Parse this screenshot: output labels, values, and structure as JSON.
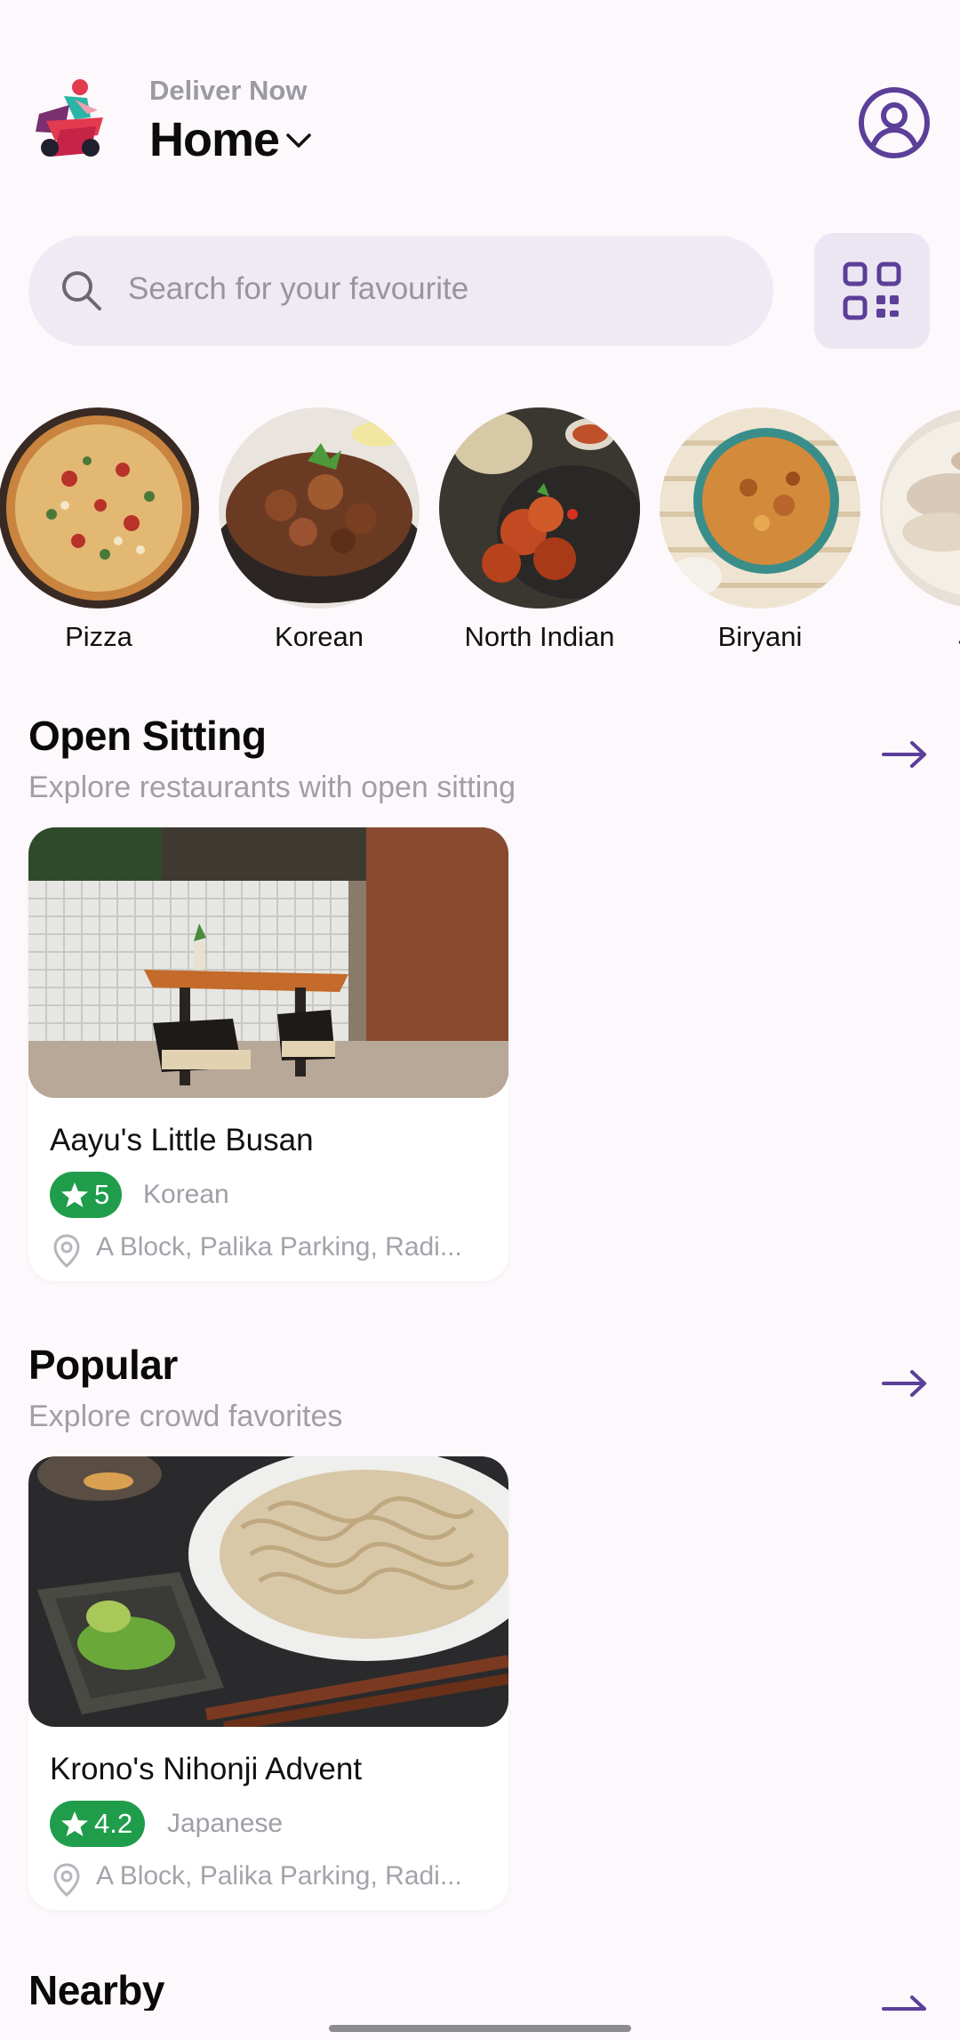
{
  "header": {
    "deliver_label": "Deliver Now",
    "location": "Home",
    "logo_icon": "delivery-rider-logo",
    "profile_icon": "user-circle-icon"
  },
  "search": {
    "placeholder": "Search for your favourite",
    "icon": "search-icon",
    "qr_icon": "qr-code-icon"
  },
  "categories": [
    {
      "label": "Pizza"
    },
    {
      "label": "Korean"
    },
    {
      "label": "North Indian"
    },
    {
      "label": "Biryani"
    },
    {
      "label": "Jap"
    }
  ],
  "sections": [
    {
      "title": "Open Sitting",
      "subtitle": "Explore restaurants with open sitting",
      "card": {
        "name": "Aayu's Little Busan",
        "rating": "5",
        "cuisine": "Korean",
        "address": "A Block, Palika Parking, Radi..."
      }
    },
    {
      "title": "Popular",
      "subtitle": "Explore crowd favorites",
      "card": {
        "name": "Krono's Nihonji Advent",
        "rating": "4.2",
        "cuisine": "Japanese",
        "address": "A Block, Palika Parking, Radi..."
      }
    },
    {
      "title": "Nearby"
    }
  ],
  "colors": {
    "accent": "#5b3f98",
    "rating_green": "#1f9d4b",
    "background": "#fdf8fc"
  }
}
